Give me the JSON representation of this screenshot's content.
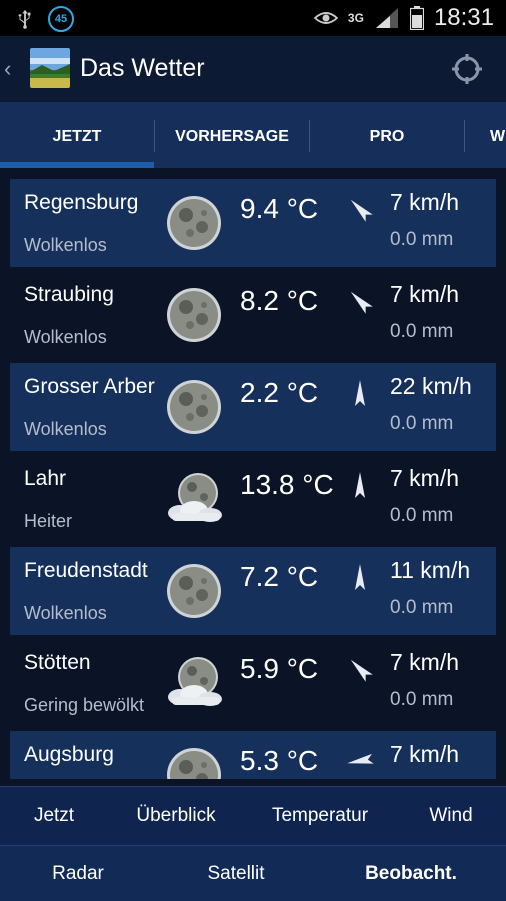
{
  "status_bar": {
    "notification_count": "45",
    "network": "3G",
    "time": "18:31"
  },
  "app": {
    "title": "Das Wetter"
  },
  "tabs": [
    {
      "label": "JETZT",
      "active": true
    },
    {
      "label": "VORHERSAGE",
      "active": false
    },
    {
      "label": "PRO",
      "active": false
    },
    {
      "label": "W",
      "active": false
    }
  ],
  "rows": [
    {
      "city": "Regensburg",
      "condition": "Wolkenlos",
      "icon": "moon-icon",
      "temp": "9.4 °C",
      "wind_dir": "sw",
      "wind": "7 km/h",
      "rain": "0.0 mm"
    },
    {
      "city": "Straubing",
      "condition": "Wolkenlos",
      "icon": "moon-icon",
      "temp": "8.2 °C",
      "wind_dir": "sw",
      "wind": "7 km/h",
      "rain": "0.0 mm"
    },
    {
      "city": "Grosser Arber",
      "condition": "Wolkenlos",
      "icon": "moon-icon",
      "temp": "2.2 °C",
      "wind_dir": "n",
      "wind": "22 km/h",
      "rain": "0.0 mm"
    },
    {
      "city": "Lahr",
      "condition": "Heiter",
      "icon": "moon-cloud-icon",
      "temp": "13.8 °C",
      "wind_dir": "n",
      "wind": "7 km/h",
      "rain": "0.0 mm"
    },
    {
      "city": "Freudenstadt",
      "condition": "Wolkenlos",
      "icon": "moon-icon",
      "temp": "7.2 °C",
      "wind_dir": "n",
      "wind": "11 km/h",
      "rain": "0.0 mm"
    },
    {
      "city": "Stötten",
      "condition": "Gering bewölkt",
      "icon": "moon-cloud-icon",
      "temp": "5.9 °C",
      "wind_dir": "sw",
      "wind": "7 km/h",
      "rain": "0.0 mm"
    },
    {
      "city": "Augsburg",
      "condition": "",
      "icon": "moon-icon",
      "temp": "5.3 °C",
      "wind_dir": "w",
      "wind": "7 km/h",
      "rain": ""
    }
  ],
  "bottom_nav": {
    "row1": [
      "Jetzt",
      "Überblick",
      "Temperatur",
      "Wind"
    ],
    "row2": [
      "Radar",
      "Satellit",
      "Beobacht."
    ]
  },
  "colors": {
    "background": "#0b1426",
    "row_highlight": "#16305c",
    "tab_bar": "#152f5a",
    "accent": "#31a9e6"
  }
}
